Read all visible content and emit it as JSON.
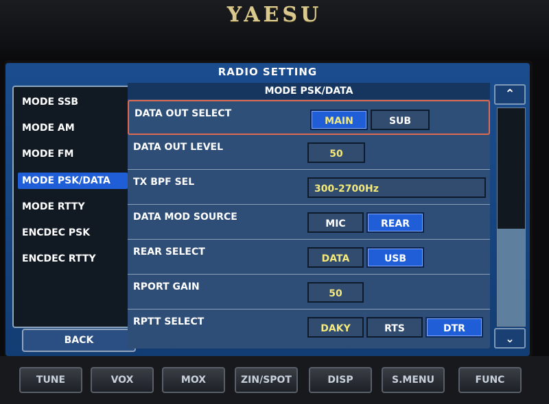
{
  "device": {
    "brand": "YAESU"
  },
  "screen": {
    "title": "RADIO SETTING",
    "menu": [
      {
        "label": "MODE SSB",
        "active": false
      },
      {
        "label": "MODE AM",
        "active": false
      },
      {
        "label": "MODE FM",
        "active": false
      },
      {
        "label": "MODE PSK/DATA",
        "active": true
      },
      {
        "label": "MODE RTTY",
        "active": false
      },
      {
        "label": "ENCDEC PSK",
        "active": false
      },
      {
        "label": "ENCDEC RTTY",
        "active": false
      }
    ],
    "back_label": "BACK",
    "panel_title": "MODE PSK/DATA",
    "settings": [
      {
        "label": "DATA OUT SELECT",
        "options": [
          "MAIN",
          "SUB"
        ],
        "selected": "MAIN"
      },
      {
        "label": "DATA OUT LEVEL",
        "value": "50"
      },
      {
        "label": "TX BPF SEL",
        "value": "300-2700Hz"
      },
      {
        "label": "DATA MOD SOURCE",
        "options": [
          "MIC",
          "REAR"
        ],
        "selected": "REAR"
      },
      {
        "label": "REAR SELECT",
        "options": [
          "DATA",
          "USB"
        ],
        "selected": "USB"
      },
      {
        "label": "RPORT GAIN",
        "value": "50"
      },
      {
        "label": "RPTT SELECT",
        "options": [
          "DAKY",
          "RTS",
          "DTR"
        ],
        "selected": "DTR"
      }
    ],
    "scroll": {
      "up_icon": "chevron-up-icon",
      "down_icon": "chevron-down-icon"
    }
  },
  "hardware_buttons": [
    "TUNE",
    "VOX",
    "MOX",
    "ZIN/SPOT",
    "DISP",
    "S.MENU",
    "FUNC"
  ]
}
